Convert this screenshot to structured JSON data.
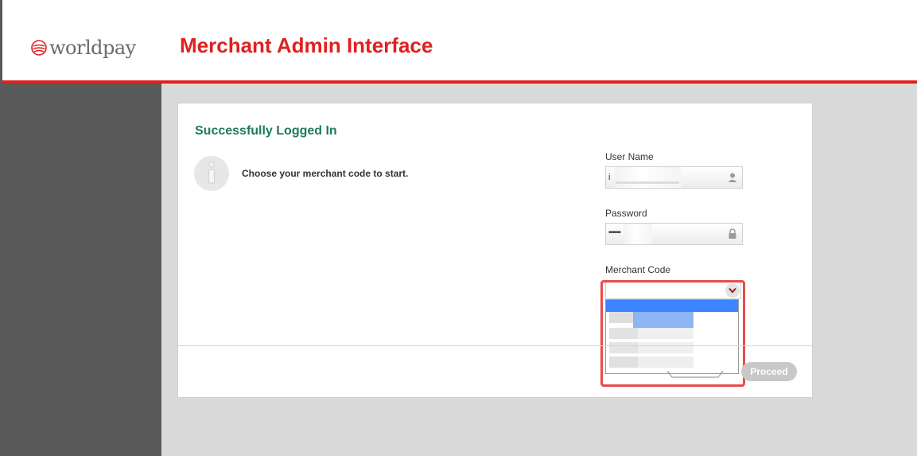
{
  "header": {
    "logo_text": "worldpay",
    "app_title": "Merchant Admin Interface"
  },
  "card": {
    "success_title": "Successfully Logged In",
    "info_message": "Choose your merchant code to start."
  },
  "form": {
    "username_label": "User Name",
    "username_value": "i",
    "password_label": "Password",
    "password_value": "••••••",
    "merchant_code_label": "Merchant Code",
    "proceed_label": "Proceed"
  },
  "icons": {
    "logo": "worldpay-globe-icon",
    "info": "info-icon",
    "user": "user-icon",
    "lock": "lock-icon",
    "select_arrow": "chevron-down-icon"
  },
  "colors": {
    "brand_red": "#e02020",
    "success_green": "#1f7a5c",
    "sidebar": "#595959",
    "selected_option": "#3b86ff",
    "highlight": "#e84c4c"
  }
}
